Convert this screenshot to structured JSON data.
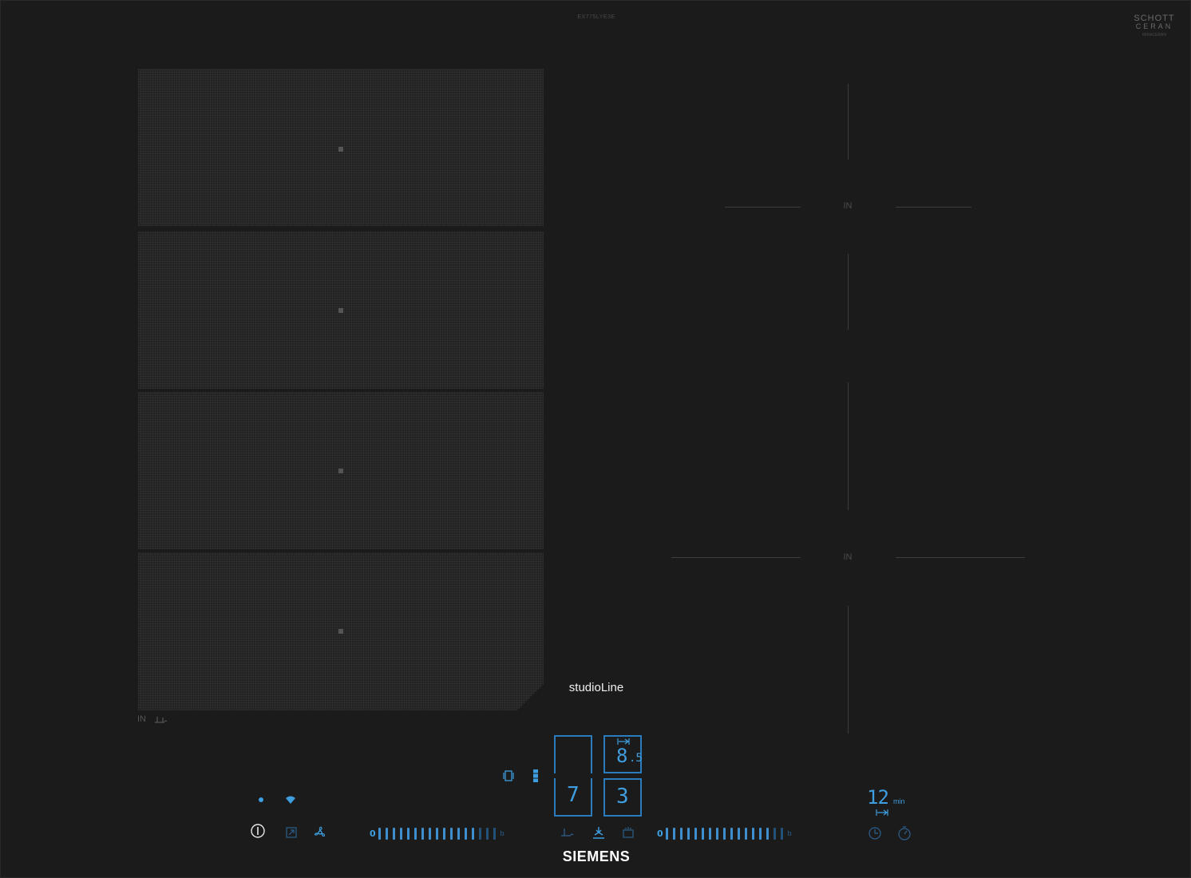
{
  "cooktop": {
    "model_code": "EX775LYE3E",
    "glass_brand": "SCHOTT",
    "glass_line": "CERAN",
    "glass_sub": "MIRACERAN",
    "series": "studioLine",
    "brand": "SIEMENS",
    "induction_mark": "IN"
  },
  "displays": {
    "top_right_value": "8",
    "top_right_decimal": ".5",
    "bottom_left_value": "7",
    "bottom_right_value": "3",
    "timer_value": "12",
    "timer_unit": "min"
  },
  "controls": {
    "power_label": "ⓘ",
    "left_slider": {
      "start": "0",
      "end": "b",
      "level_fraction": 0.85,
      "steps": 17
    },
    "right_slider": {
      "start": "0",
      "end": "b",
      "level_fraction": 0.9,
      "steps": 17
    }
  },
  "icons": {
    "power": "power-icon",
    "wifi": "wifi-icon",
    "hood_link": "hood-link-icon",
    "fan": "fan-icon",
    "flex_mode": "flex-mode-icon",
    "move_mode": "move-mode-icon",
    "pan_sensor": "pan-sensor-icon",
    "frying_sensor": "frying-sensor-icon",
    "keep_warm": "keep-warm-icon",
    "timer": "timer-icon",
    "stopwatch": "stopwatch-icon"
  },
  "colors": {
    "glass": "#1b1b1b",
    "accent": "#3e9ee0",
    "text": "#ffffff"
  }
}
